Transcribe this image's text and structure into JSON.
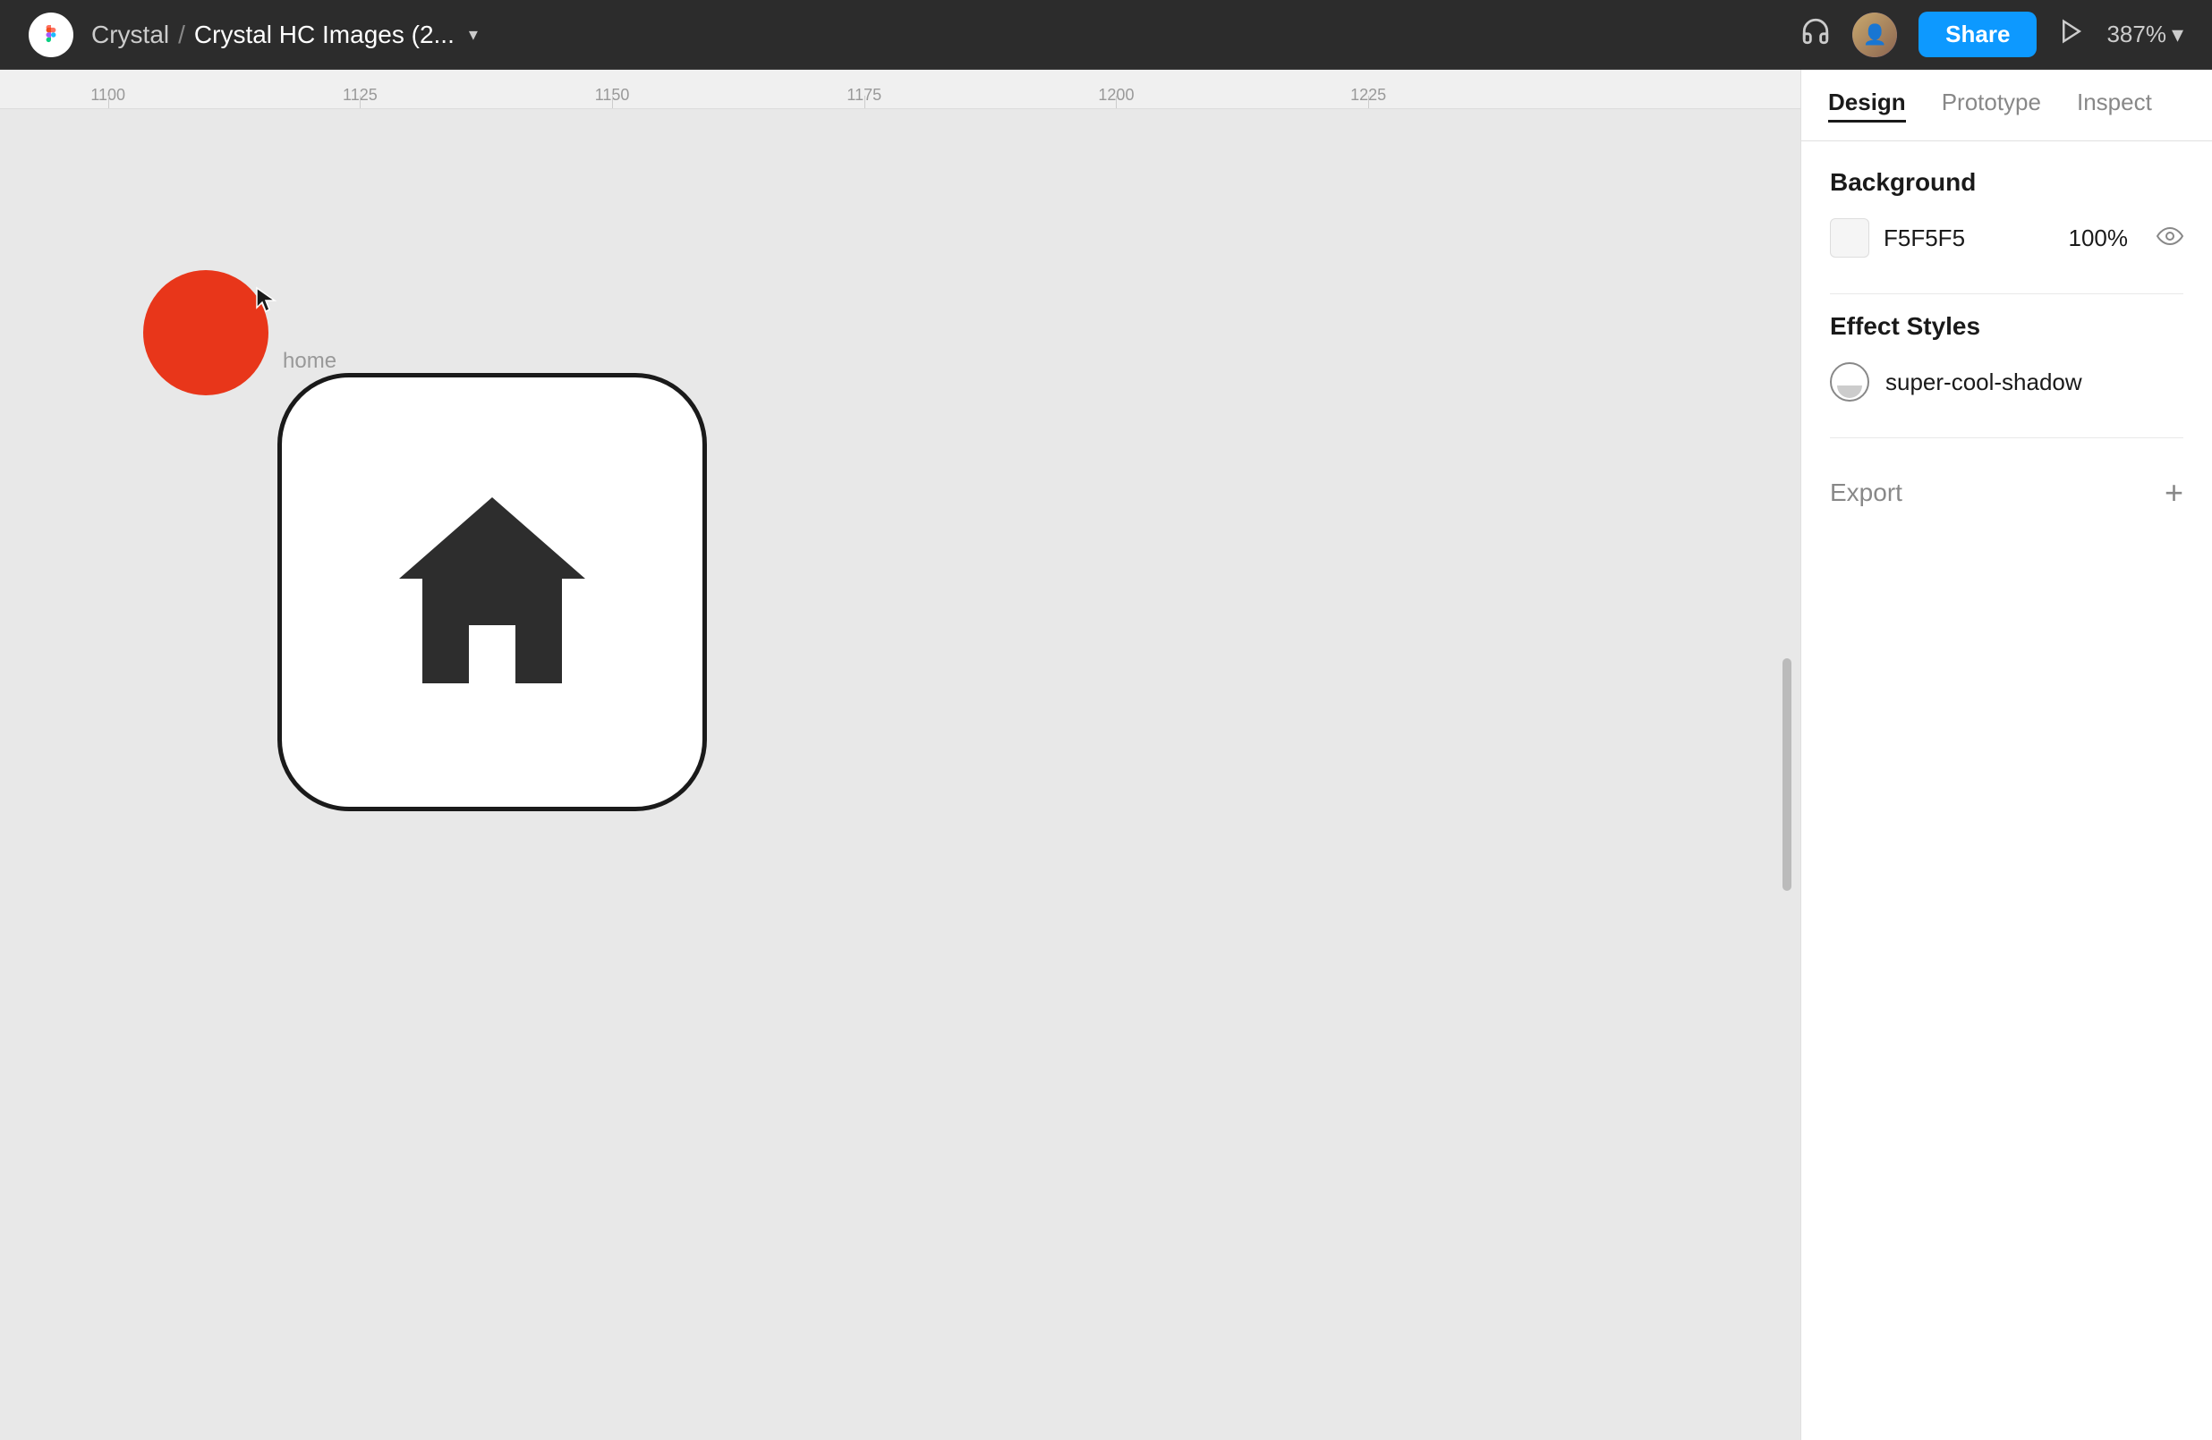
{
  "topbar": {
    "logo": "F",
    "breadcrumb_org": "Crystal",
    "breadcrumb_sep": "/",
    "breadcrumb_file": "Crystal HC Images (2...",
    "share_label": "Share",
    "zoom_label": "387%"
  },
  "ruler": {
    "marks": [
      1100,
      1125,
      1150,
      1175,
      1200,
      1225
    ]
  },
  "canvas": {
    "home_label": "home"
  },
  "right_panel": {
    "tabs": [
      {
        "id": "design",
        "label": "Design",
        "active": true
      },
      {
        "id": "prototype",
        "label": "Prototype",
        "active": false
      },
      {
        "id": "inspect",
        "label": "Inspect",
        "active": false
      }
    ],
    "background_section": {
      "title": "Background",
      "color_hex": "F5F5F5",
      "opacity": "100%"
    },
    "effect_styles_section": {
      "title": "Effect Styles",
      "items": [
        {
          "name": "super-cool-shadow"
        }
      ]
    },
    "export_section": {
      "title": "Export",
      "add_label": "+"
    }
  }
}
